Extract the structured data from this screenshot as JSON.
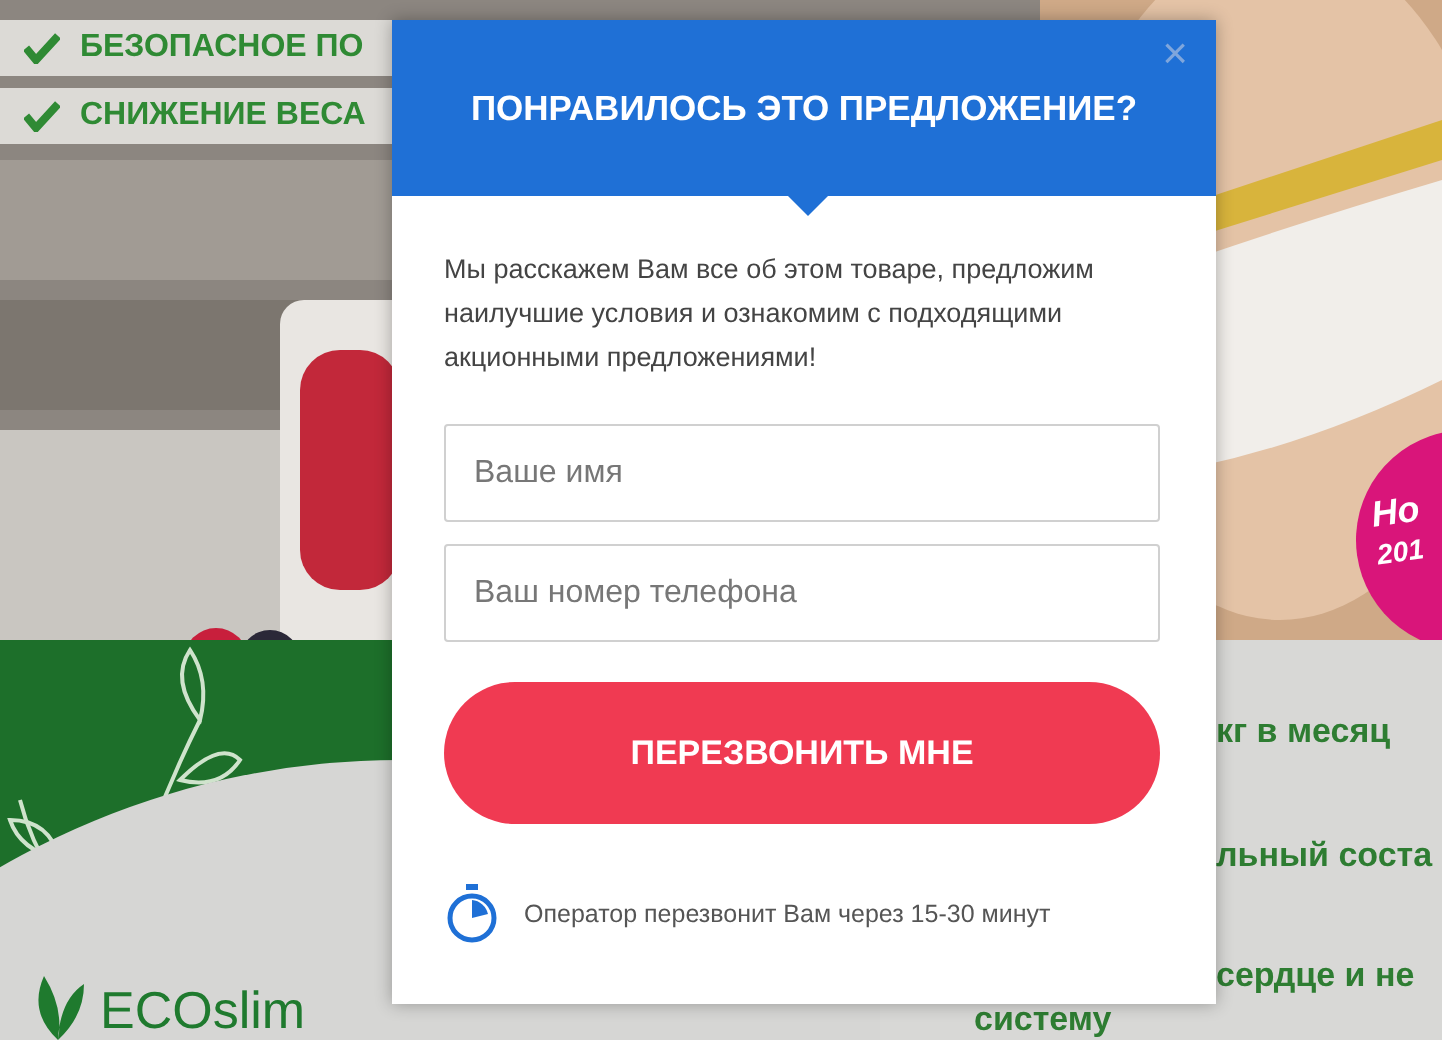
{
  "page": {
    "checklist": [
      {
        "text": "БЕЗОПАСНОЕ ПО"
      },
      {
        "text": "СНИЖЕНИЕ ВЕСА"
      }
    ],
    "badge": {
      "lines": [
        "Но",
        "201"
      ]
    },
    "logo": {
      "text": "ECOslim"
    },
    "benefits": [
      "кг в месяц",
      "льный соста",
      "сердце и не",
      "систему"
    ]
  },
  "modal": {
    "title": "ПОНРАВИЛОСЬ ЭТО ПРЕДЛОЖЕНИЕ?",
    "close": "×",
    "description": "Мы расскажем Вам все об этом товаре, предложим наилучшие условия и ознакомим с подходящими акционными предложениями!",
    "fields": [
      {
        "placeholder": "Ваше имя"
      },
      {
        "placeholder": "Ваш номер телефона"
      }
    ],
    "submit": "ПЕРЕЗВОНИТЬ МНЕ",
    "note": "Оператор перезвонит Вам через 15-30 минут"
  }
}
